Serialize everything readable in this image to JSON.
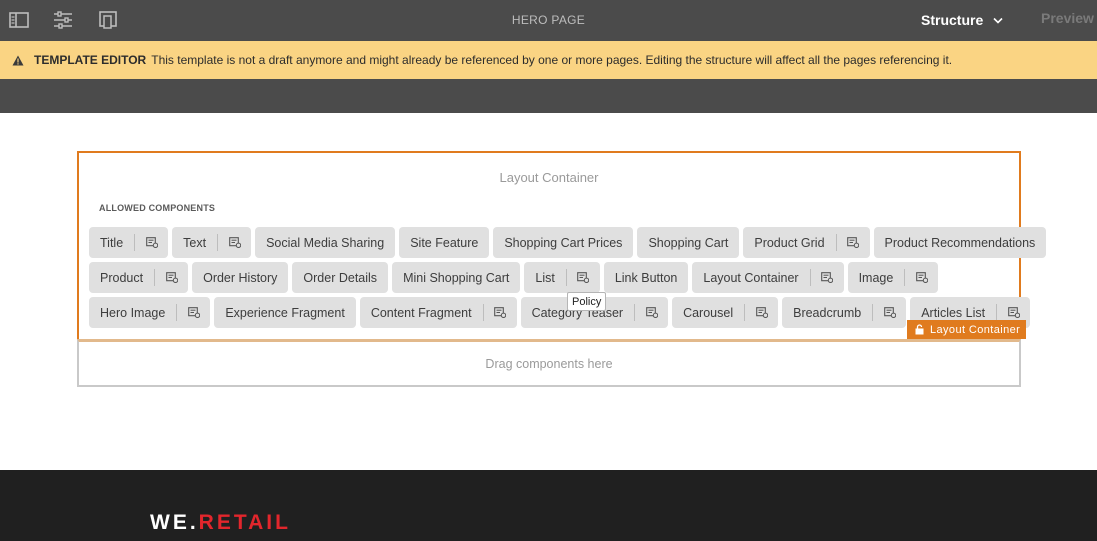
{
  "toolbar": {
    "page_title": "HERO PAGE",
    "mode": "Structure",
    "preview_label": "Preview",
    "icons": [
      "side-panel-icon",
      "page-properties-icon",
      "emulator-icon"
    ]
  },
  "banner": {
    "title": "TEMPLATE EDITOR",
    "message": "This template is not a draft anymore and might already be referenced by one or more pages. Editing the structure will affect all the pages referencing it."
  },
  "layout_container": {
    "title": "Layout Container",
    "allowed_heading": "ALLOWED COMPONENTS",
    "badge_label": "Layout Container",
    "tooltip": "Policy",
    "rows": [
      [
        {
          "label": "Title",
          "policy": true
        },
        {
          "label": "Text",
          "policy": true
        },
        {
          "label": "Social Media Sharing",
          "policy": false
        },
        {
          "label": "Site Feature",
          "policy": false
        },
        {
          "label": "Shopping Cart Prices",
          "policy": false
        },
        {
          "label": "Shopping Cart",
          "policy": false
        },
        {
          "label": "Product Grid",
          "policy": true
        },
        {
          "label": "Product Recommendations",
          "policy": false
        }
      ],
      [
        {
          "label": "Product",
          "policy": true
        },
        {
          "label": "Order History",
          "policy": false
        },
        {
          "label": "Order Details",
          "policy": false
        },
        {
          "label": "Mini Shopping Cart",
          "policy": false
        },
        {
          "label": "List",
          "policy": true
        },
        {
          "label": "Link Button",
          "policy": false
        },
        {
          "label": "Layout Container",
          "policy": true
        },
        {
          "label": "Image",
          "policy": true
        }
      ],
      [
        {
          "label": "Hero Image",
          "policy": true
        },
        {
          "label": "Experience Fragment",
          "policy": false
        },
        {
          "label": "Content Fragment",
          "policy": true
        },
        {
          "label": "Category Teaser",
          "policy": true
        },
        {
          "label": "Carousel",
          "policy": true
        },
        {
          "label": "Breadcrumb",
          "policy": true
        },
        {
          "label": "Articles List",
          "policy": true
        }
      ]
    ]
  },
  "dropzone": {
    "text": "Drag components here"
  },
  "footer": {
    "logo_part1": "WE.",
    "logo_part2": "RETAIL"
  },
  "colors": {
    "toolbar": "#4b4b4b",
    "banner": "#fad483",
    "accent": "#e07b1e",
    "chip": "#e0e0e0",
    "footer": "#202020",
    "brand_red": "#e2262c"
  }
}
